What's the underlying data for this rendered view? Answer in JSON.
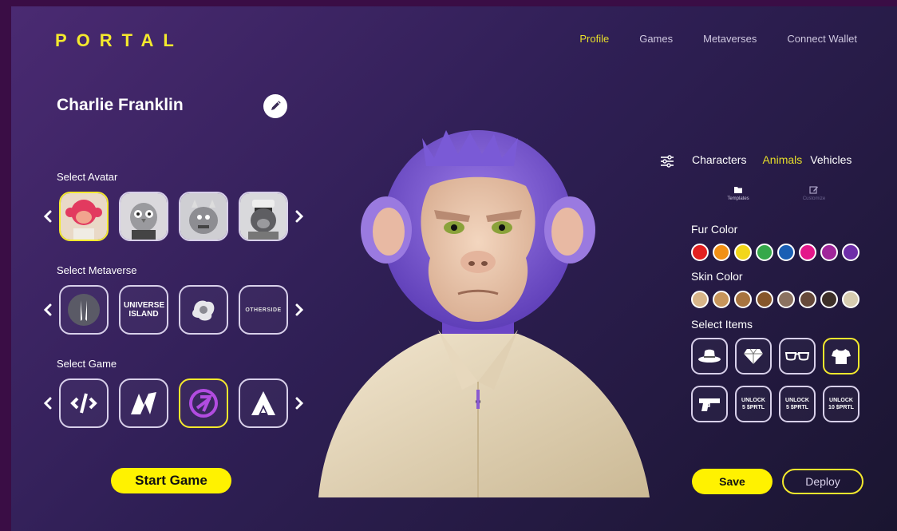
{
  "brand": {
    "logo": "PORTAL"
  },
  "nav": [
    {
      "label": "Profile",
      "active": true
    },
    {
      "label": "Games",
      "active": false
    },
    {
      "label": "Metaverses",
      "active": false
    },
    {
      "label": "Connect Wallet",
      "active": false
    }
  ],
  "profile": {
    "name": "Charlie Franklin"
  },
  "sections": {
    "avatar": "Select Avatar",
    "metaverse": "Select Metaverse",
    "game": "Select Game"
  },
  "metaverse_tiles": [
    {
      "text": ""
    },
    {
      "text": "UNIVERSE ISLAND"
    },
    {
      "text": ""
    },
    {
      "text": "OTHERSIDE"
    }
  ],
  "start_button": "Start Game",
  "category_tabs": [
    {
      "label": "Characters",
      "active": false
    },
    {
      "label": "Animals",
      "active": true
    },
    {
      "label": "Vehicles",
      "active": false
    }
  ],
  "subtools": [
    {
      "label": "Templates"
    },
    {
      "label": "Customize"
    }
  ],
  "fur_color": {
    "label": "Fur Color",
    "colors": [
      "#e32020",
      "#f29015",
      "#f2d61a",
      "#35a84a",
      "#1a5fb4",
      "#e3188a",
      "#a0269a",
      "#6e2ea8"
    ]
  },
  "skin_color": {
    "label": "Skin Color",
    "colors": [
      "#d8b589",
      "#c7955b",
      "#a8743f",
      "#86562a",
      "#8b7260",
      "#66493a",
      "#3d2f28",
      "#d7ccb0"
    ]
  },
  "items": {
    "label": "Select Items",
    "unlock": [
      {
        "line1": "UNLOCK",
        "line2": "5 $PRTL"
      },
      {
        "line1": "UNLOCK",
        "line2": "5 $PRTL"
      },
      {
        "line1": "UNLOCK",
        "line2": "10 $PRTL"
      }
    ]
  },
  "buttons": {
    "save": "Save",
    "deploy": "Deploy"
  },
  "colors": {
    "accent": "#f4e92d",
    "background": "#3a0d45"
  }
}
